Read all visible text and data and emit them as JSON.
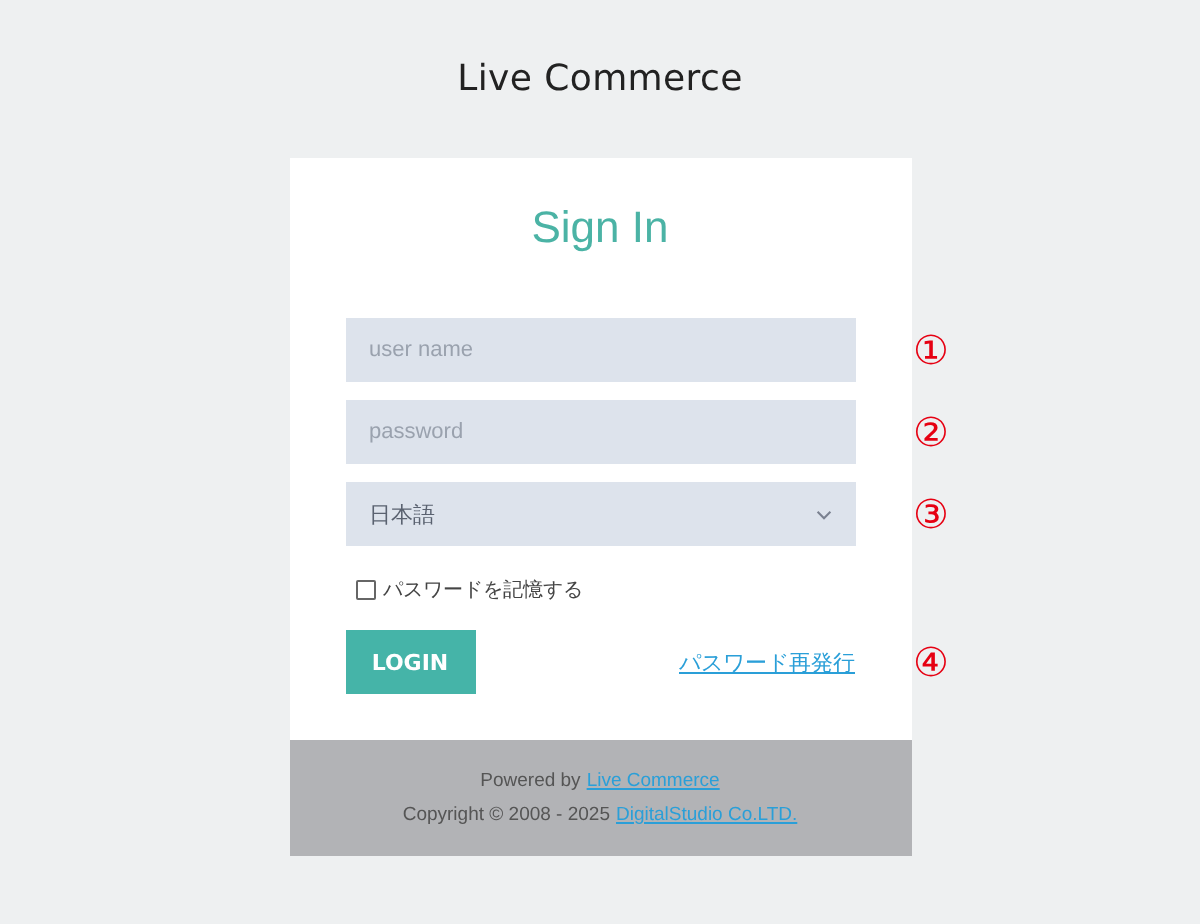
{
  "logo": "Live Commerce",
  "title": "Sign In",
  "fields": [
    {
      "kind": "text",
      "placeholder": "user name",
      "marker": "①"
    },
    {
      "kind": "password",
      "placeholder": "password",
      "marker": "②"
    },
    {
      "kind": "select",
      "value": "日本語",
      "marker": "③"
    }
  ],
  "remember": {
    "label": "パスワードを記憶する",
    "checked": false
  },
  "login_button": "LOGIN",
  "reset_link": {
    "label": "パスワード再発行",
    "marker": "④"
  },
  "footer": {
    "powered_prefix": "Powered by",
    "powered_link": "Live Commerce",
    "copyright": "Copyright © 2008 - 2025",
    "company_link": "DigitalStudio Co.LTD."
  }
}
